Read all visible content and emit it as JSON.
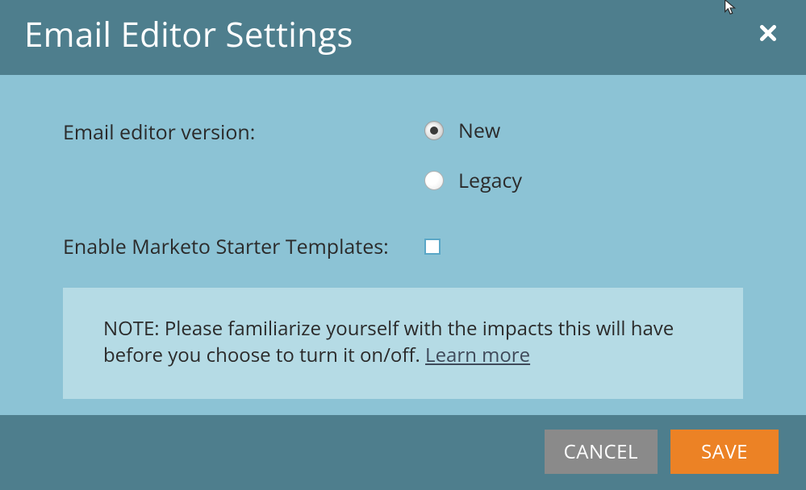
{
  "dialog": {
    "title": "Email Editor Settings"
  },
  "form": {
    "version_label": "Email editor version:",
    "version_options": {
      "new": "New",
      "legacy": "Legacy"
    },
    "version_selected": "new",
    "templates_label": "Enable Marketo Starter Templates:",
    "templates_checked": false
  },
  "note": {
    "prefix": "NOTE:",
    "text": " Please familiarize yourself with the impacts this will have before you choose to turn it on/off. ",
    "learn_more": "Learn more"
  },
  "footer": {
    "cancel": "CANCEL",
    "save": "SAVE"
  }
}
